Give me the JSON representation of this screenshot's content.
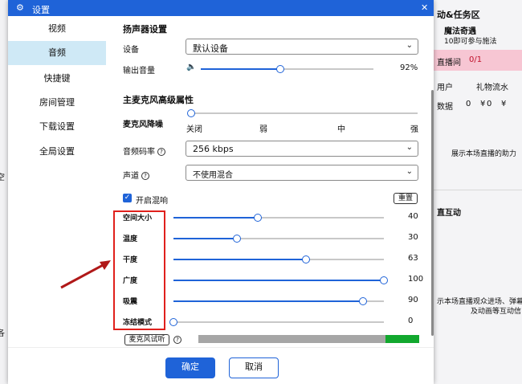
{
  "dialog": {
    "title": "设置",
    "close": "✕"
  },
  "sidebar": {
    "items": [
      {
        "label": "视频"
      },
      {
        "label": "音频"
      },
      {
        "label": "快捷键"
      },
      {
        "label": "房间管理"
      },
      {
        "label": "下载设置"
      },
      {
        "label": "全局设置"
      }
    ],
    "active_index": 1
  },
  "speaker": {
    "heading": "扬声器设置",
    "device_label": "设备",
    "device_value": "默认设备",
    "volume_label": "输出音量",
    "volume_value": "92%",
    "volume_level": 0.92
  },
  "mic": {
    "heading": "主麦克风高级属性",
    "noise_label": "麦克风降噪",
    "noise_levels": [
      "关闭",
      "弱",
      "中",
      "强"
    ],
    "bitrate_label": "音频码率",
    "bitrate_value": "256 kbps",
    "channel_label": "声道",
    "channel_value": "不使用混合"
  },
  "reverb": {
    "enable_label": "开启混响",
    "enabled": true,
    "reset_label": "重置",
    "sliders": [
      {
        "label": "空间大小",
        "value": "40"
      },
      {
        "label": "温度",
        "value": "30"
      },
      {
        "label": "干度",
        "value": "63"
      },
      {
        "label": "广度",
        "value": "100"
      },
      {
        "label": "吸震",
        "value": "90"
      },
      {
        "label": "冻结模式",
        "value": "0"
      }
    ]
  },
  "mic_test": {
    "button_label": "麦克风试听"
  },
  "footer": {
    "ok_label": "确定",
    "cancel_label": "取消"
  },
  "background_app": {
    "right_texts": [
      "动&任务区",
      "魔法奇遇",
      "10即可参与施法",
      "直播间",
      "0/1",
      "用户",
      "礼物流水",
      "数据",
      "0",
      "¥",
      "0",
      "¥",
      "展示本场直播的助力",
      "直互动",
      "示本场直播观众进场、弹幕",
      "及动画等互动信"
    ],
    "left_texts": [
      "空",
      "各"
    ]
  },
  "colors": {
    "primary": "#1f63d8",
    "active_nav": "#cfe9f6",
    "annotation": "#e0201c",
    "level_green": "#12a82e"
  }
}
